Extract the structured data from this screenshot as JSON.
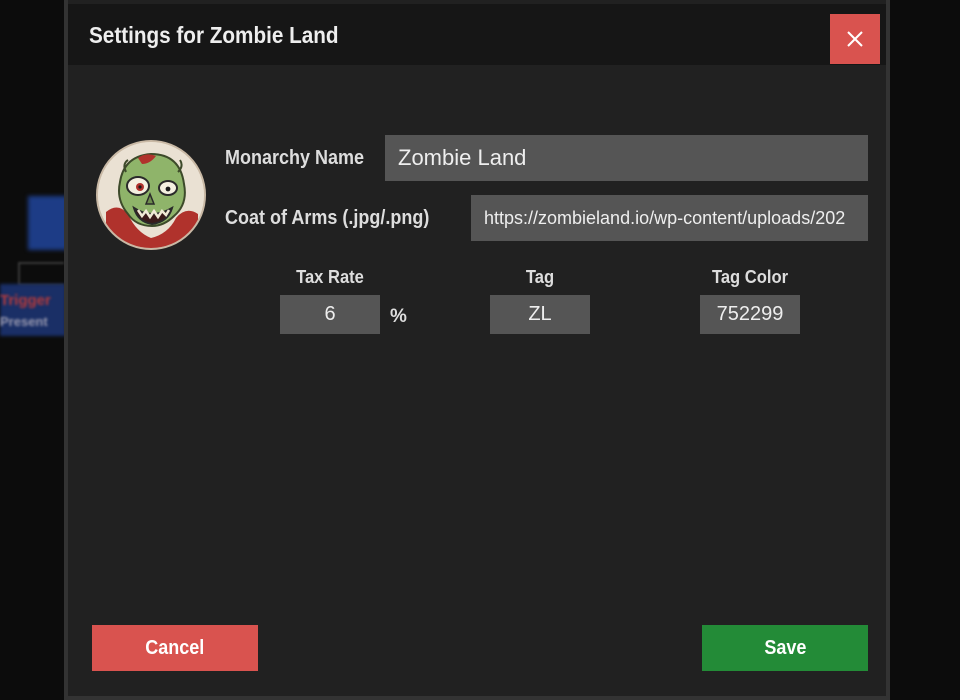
{
  "modal": {
    "title": "Settings for Zombie Land",
    "close_icon": "close-icon"
  },
  "background": {
    "partial_red_text": "Trigger",
    "partial_gray_text": "Present"
  },
  "avatar": {
    "icon": "zombie-coat-of-arms"
  },
  "form": {
    "monarchy_name_label": "Monarchy Name",
    "monarchy_name_value": "Zombie Land",
    "coat_of_arms_label": "Coat of Arms (.jpg/.png)",
    "coat_of_arms_value": "https://zombieland.io/wp-content/uploads/202",
    "tax_rate_label": "Tax Rate",
    "tax_rate_value": "6",
    "tax_rate_unit": "%",
    "tag_label": "Tag",
    "tag_value": "ZL",
    "tag_color_label": "Tag Color",
    "tag_color_value": "752299"
  },
  "actions": {
    "cancel_label": "Cancel",
    "save_label": "Save"
  },
  "colors": {
    "danger": "#d9534f",
    "success": "#238b37",
    "modal_bg": "#212121",
    "header_bg": "#161616",
    "input_bg": "#555555"
  }
}
